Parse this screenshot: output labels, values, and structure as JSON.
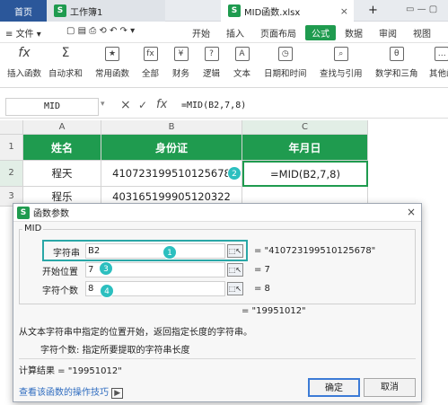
{
  "tabs": {
    "home": "首页",
    "workbook": "工作簿1",
    "active": "MID函数.xlsx",
    "new_tab": "+"
  },
  "menu": {
    "file": "文件",
    "items": [
      "开始",
      "插入",
      "页面布局",
      "公式",
      "数据",
      "审阅",
      "视图"
    ]
  },
  "ribbon": [
    "插入函数",
    "自动求和",
    "常用函数",
    "全部",
    "财务",
    "逻辑",
    "文本",
    "日期和时间",
    "查找与引用",
    "数学和三角",
    "其他函"
  ],
  "formula_bar": {
    "cell_ref": "MID",
    "cancel": "×",
    "confirm": "✓",
    "fx": "fx",
    "formula": "=MID(B2,7,8)"
  },
  "grid": {
    "columns": [
      "A",
      "B",
      "C"
    ],
    "rows": [
      "1",
      "2",
      "3"
    ],
    "headers": [
      "姓名",
      "身份证",
      "年月日"
    ],
    "data": [
      [
        "程天",
        "410723199510125678",
        "=MID(B2,7,8)"
      ],
      [
        "程乐",
        "403165199905120322",
        ""
      ]
    ]
  },
  "badges": [
    "1",
    "2",
    "3",
    "4"
  ],
  "dialog": {
    "title": "函数参数",
    "close": "×",
    "function_name": "MID",
    "args": [
      {
        "label": "字符串",
        "value": "B2",
        "result": "= \"410723199510125678\""
      },
      {
        "label": "开始位置",
        "value": "7",
        "result": "= 7"
      },
      {
        "label": "字符个数",
        "value": "8",
        "result": "= 8"
      }
    ],
    "formula_result_preview": "= \"19951012\"",
    "description": "从文本字符串中指定的位置开始，返回指定长度的字符串。",
    "arg_help": "字符个数:  指定所要提取的字符串长度",
    "result_label": "计算结果 =  \"19951012\"",
    "help_link": "查看该函数的操作技巧",
    "ok": "确定",
    "cancel": "取消"
  },
  "colors": {
    "accent": "#1f9b4f",
    "badge": "#2cbfbf",
    "link": "#2d6bbf"
  }
}
